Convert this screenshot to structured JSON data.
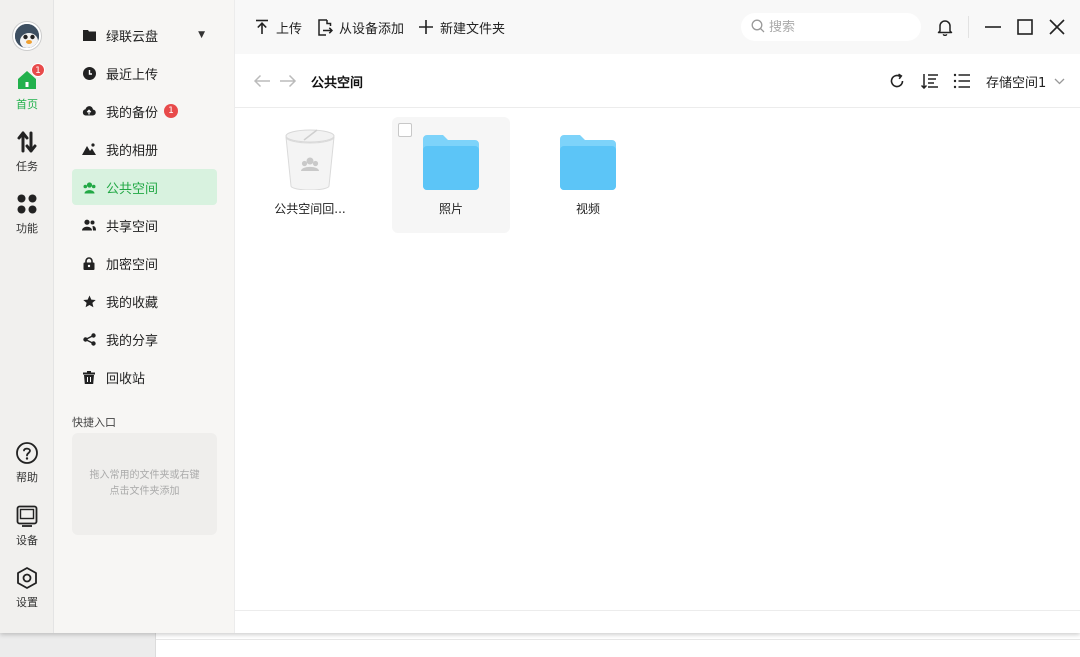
{
  "rail": {
    "home_label": "首页",
    "home_badge": "1",
    "tasks_label": "任务",
    "features_label": "功能",
    "help_label": "帮助",
    "devices_label": "设备",
    "settings_label": "设置"
  },
  "sidebar": {
    "items": [
      {
        "label": "绿联云盘",
        "icon": "folder-icon"
      },
      {
        "label": "最近上传",
        "icon": "clock-icon"
      },
      {
        "label": "我的备份",
        "icon": "cloud-upload-icon",
        "badge": "1"
      },
      {
        "label": "我的相册",
        "icon": "mountain-image-icon"
      },
      {
        "label": "公共空间",
        "icon": "group-icon",
        "active": true
      },
      {
        "label": "共享空间",
        "icon": "users-icon"
      },
      {
        "label": "加密空间",
        "icon": "lock-icon"
      },
      {
        "label": "我的收藏",
        "icon": "star-icon"
      },
      {
        "label": "我的分享",
        "icon": "share-icon"
      },
      {
        "label": "回收站",
        "icon": "trash-icon"
      }
    ],
    "quick_title": "快捷入口",
    "quick_hint": "拖入常用的文件夹或右键点击文件夹添加"
  },
  "toolbar": {
    "upload_label": "上传",
    "add_from_device_label": "从设备添加",
    "new_folder_label": "新建文件夹"
  },
  "search": {
    "placeholder": "搜索",
    "value": ""
  },
  "path": {
    "title": "公共空间",
    "storage": "存储空间1"
  },
  "files": [
    {
      "name": "公共空间回...",
      "type": "recycle-bin"
    },
    {
      "name": "照片",
      "type": "folder"
    },
    {
      "name": "视频",
      "type": "folder"
    }
  ],
  "colors": {
    "accent": "#22b14c",
    "folder": "#5cc5f7",
    "badge": "#e84a4a"
  }
}
